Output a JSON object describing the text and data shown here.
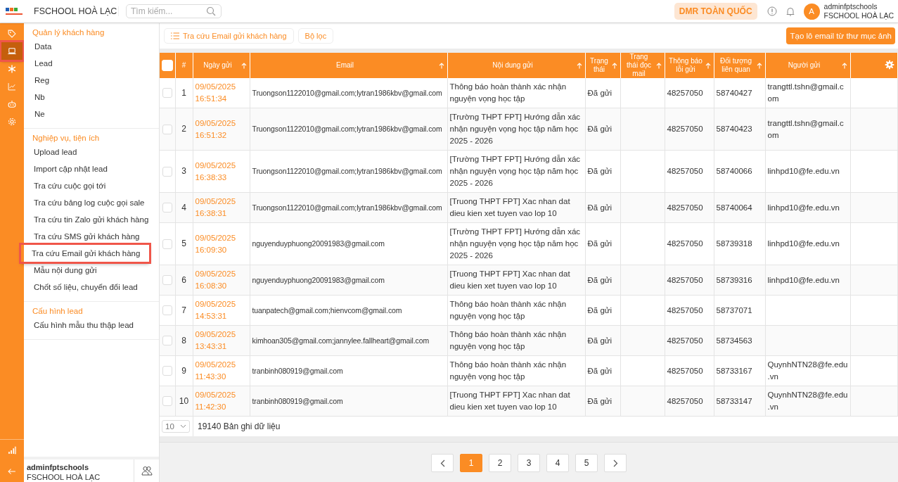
{
  "header": {
    "title": "FSCHOOL HOÀ LẠC",
    "search": {
      "placeholder": "Tìm kiếm..."
    },
    "scope_button": "DMR TOÀN QUỐC",
    "user": {
      "avatar_letter": "A",
      "name": "adminfptschools",
      "org": "FSCHOOL HOÀ LẠC"
    }
  },
  "rail": {
    "items": [
      {
        "kind": "tag",
        "selected": false,
        "highlighted": false
      },
      {
        "kind": "laptop",
        "selected": true,
        "highlighted": true
      },
      {
        "kind": "asterisk",
        "selected": false,
        "highlighted": false
      },
      {
        "kind": "chart",
        "selected": false,
        "highlighted": false
      },
      {
        "kind": "robot",
        "selected": false,
        "highlighted": false
      },
      {
        "kind": "gear",
        "selected": false,
        "highlighted": false
      }
    ],
    "bottom_items": [
      {
        "kind": "bars"
      },
      {
        "kind": "back"
      }
    ]
  },
  "sidebar": {
    "sections": [
      {
        "title": "Quản lý khách hàng",
        "items": [
          {
            "label": "Data",
            "highlighted": false
          },
          {
            "label": "Lead",
            "highlighted": false
          },
          {
            "label": "Reg",
            "highlighted": false
          },
          {
            "label": "Nb",
            "highlighted": false
          },
          {
            "label": "Ne",
            "highlighted": false
          }
        ]
      },
      {
        "title": "Nghiệp vụ, tiện ích",
        "items": [
          {
            "label": "Upload lead",
            "highlighted": false
          },
          {
            "label": "Import cập nhật lead",
            "highlighted": false
          },
          {
            "label": "Tra cứu cuộc gọi tới",
            "highlighted": false
          },
          {
            "label": "Tra cứu bảng log cuộc gọi sale",
            "highlighted": false
          },
          {
            "label": "Tra cứu tin Zalo gửi khách hàng",
            "highlighted": false
          },
          {
            "label": "Tra cứu SMS gửi khách hàng",
            "highlighted": false
          },
          {
            "label": "Tra cứu Email gửi khách hàng",
            "highlighted": true
          },
          {
            "label": "Mẫu nội dung gửi",
            "highlighted": false
          },
          {
            "label": "Chốt số liệu, chuyển đổi lead",
            "highlighted": false
          }
        ]
      },
      {
        "title": "Cấu hình lead",
        "items": [
          {
            "label": "Cấu hình mẫu thu thập lead",
            "highlighted": false
          }
        ]
      }
    ],
    "footer": {
      "name": "adminfptschools",
      "org": "FSCHOOL HOÀ LẠC"
    }
  },
  "toolbar": {
    "tab": "Tra cứu Email gửi khách hàng",
    "filter_button": "Bộ lọc",
    "action_button": "Tạo lô email từ thư mục ảnh"
  },
  "table": {
    "header_checked": false,
    "columns": [
      {
        "label": "#",
        "sortable": false
      },
      {
        "label": "Ngày gửi",
        "sortable": true
      },
      {
        "label": "Email",
        "sortable": true
      },
      {
        "label": "Nội dung gửi",
        "sortable": true
      },
      {
        "label": "Trạng thái",
        "sortable": true
      },
      {
        "label": "Trạng thái đọc mail",
        "sortable": true
      },
      {
        "label": "Thông báo lỗi gửi",
        "sortable": true
      },
      {
        "label": "Đối tượng liên quan",
        "sortable": true
      },
      {
        "label": "Người gửi",
        "sortable": true
      }
    ],
    "rows": [
      {
        "checked": false,
        "cells": [
          "1",
          "09/05/2025 16:51:34",
          "Truongson1122010@gmail.com;lytran1986kbv@gmail.com",
          "Thông báo hoàn thành xác nhận nguyện vọng học tập",
          "Đã gửi",
          "",
          "48257050",
          "58740427",
          "trangttl.tshn@gmail.com"
        ]
      },
      {
        "checked": false,
        "cells": [
          "2",
          "09/05/2025 16:51:32",
          "Truongson1122010@gmail.com;lytran1986kbv@gmail.com",
          "[Trường THPT FPT] Hướng dẫn xác nhận nguyện vọng học tập năm học 2025 - 2026",
          "Đã gửi",
          "",
          "48257050",
          "58740423",
          "trangttl.tshn@gmail.com"
        ]
      },
      {
        "checked": false,
        "cells": [
          "3",
          "09/05/2025 16:38:33",
          "Truongson1122010@gmail.com;lytran1986kbv@gmail.com",
          "[Trường THPT FPT] Hướng dẫn xác nhận nguyện vọng học tập năm học 2025 - 2026",
          "Đã gửi",
          "",
          "48257050",
          "58740066",
          "linhpd10@fe.edu.vn"
        ]
      },
      {
        "checked": false,
        "cells": [
          "4",
          "09/05/2025 16:38:31",
          "Truongson1122010@gmail.com;lytran1986kbv@gmail.com",
          "[Truong THPT FPT] Xac nhan dat dieu kien xet tuyen vao lop 10",
          "Đã gửi",
          "",
          "48257050",
          "58740064",
          "linhpd10@fe.edu.vn"
        ]
      },
      {
        "checked": false,
        "cells": [
          "5",
          "09/05/2025 16:09:30",
          "nguyenduyphuong20091983@gmail.com",
          "[Trường THPT FPT] Hướng dẫn xác nhận nguyện vọng học tập năm học 2025 - 2026",
          "Đã gửi",
          "",
          "48257050",
          "58739318",
          "linhpd10@fe.edu.vn"
        ]
      },
      {
        "checked": false,
        "cells": [
          "6",
          "09/05/2025 16:08:30",
          "nguyenduyphuong20091983@gmail.com",
          "[Truong THPT FPT] Xac nhan dat dieu kien xet tuyen vao lop 10",
          "Đã gửi",
          "",
          "48257050",
          "58739316",
          "linhpd10@fe.edu.vn"
        ]
      },
      {
        "checked": false,
        "cells": [
          "7",
          "09/05/2025 14:53:31",
          "tuanpatech@gmail.com;hienvcom@gmail.com",
          "Thông báo hoàn thành xác nhận nguyện vọng học tập",
          "Đã gửi",
          "",
          "48257050",
          "58737071",
          ""
        ]
      },
      {
        "checked": false,
        "cells": [
          "8",
          "09/05/2025 13:43:31",
          "kimhoan305@gmail.com;jannylee.fallheart@gmail.com",
          "Thông báo hoàn thành xác nhận nguyện vọng học tập",
          "Đã gửi",
          "",
          "48257050",
          "58734563",
          ""
        ]
      },
      {
        "checked": false,
        "cells": [
          "9",
          "09/05/2025 11:43:30",
          "tranbinh080919@gmail.com",
          "Thông báo hoàn thành xác nhận nguyện vọng học tập",
          "Đã gửi",
          "",
          "48257050",
          "58733167",
          "QuynhNTN28@fe.edu.vn"
        ]
      },
      {
        "checked": false,
        "cells": [
          "10",
          "09/05/2025 11:42:30",
          "tranbinh080919@gmail.com",
          "[Truong THPT FPT] Xac nhan dat dieu kien xet tuyen vao lop 10",
          "Đã gửi",
          "",
          "48257050",
          "58733147",
          "QuynhNTN28@fe.edu.vn"
        ]
      }
    ],
    "page_size": "10",
    "total": "19140 Bản ghi dữ liệu"
  },
  "pagination": {
    "pages": [
      {
        "label": "1",
        "selected": true
      },
      {
        "label": "2",
        "selected": false
      },
      {
        "label": "3",
        "selected": false
      },
      {
        "label": "4",
        "selected": false
      },
      {
        "label": "5",
        "selected": false
      }
    ]
  }
}
